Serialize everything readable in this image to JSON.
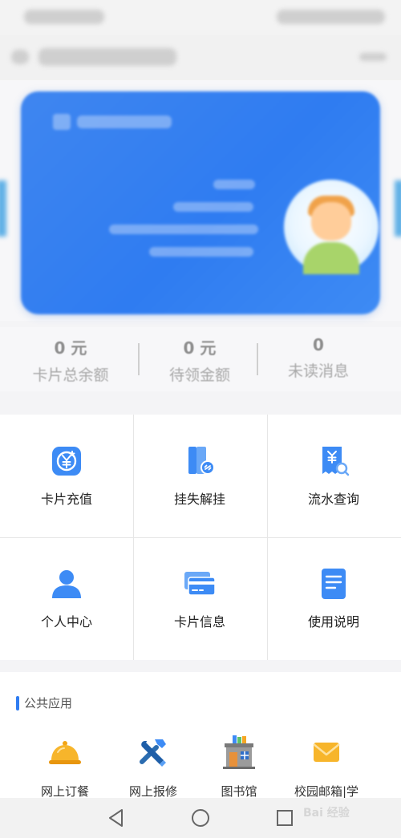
{
  "stats": [
    {
      "value": "0 元",
      "label": "卡片总余额"
    },
    {
      "value": "0 元",
      "label": "待领金额"
    },
    {
      "value": "0",
      "label": "未读消息"
    }
  ],
  "grid": [
    {
      "label": "卡片充值",
      "icon": "yuan-coin-icon"
    },
    {
      "label": "挂失解挂",
      "icon": "card-link-icon"
    },
    {
      "label": "流水查询",
      "icon": "receipt-search-icon"
    },
    {
      "label": "个人中心",
      "icon": "person-icon"
    },
    {
      "label": "卡片信息",
      "icon": "cards-icon"
    },
    {
      "label": "使用说明",
      "icon": "document-icon"
    }
  ],
  "public_apps": {
    "title": "公共应用",
    "items": [
      {
        "label": "网上订餐",
        "icon": "food-cloche-icon"
      },
      {
        "label": "网上报修",
        "icon": "repair-tools-icon"
      },
      {
        "label": "图书馆",
        "icon": "library-building-icon"
      },
      {
        "label": "校园邮箱|学",
        "icon": "mail-envelope-icon"
      }
    ]
  },
  "watermark": "Bai 经验",
  "colors": {
    "accent": "#2f7cf1",
    "card": "#3f86f0"
  }
}
